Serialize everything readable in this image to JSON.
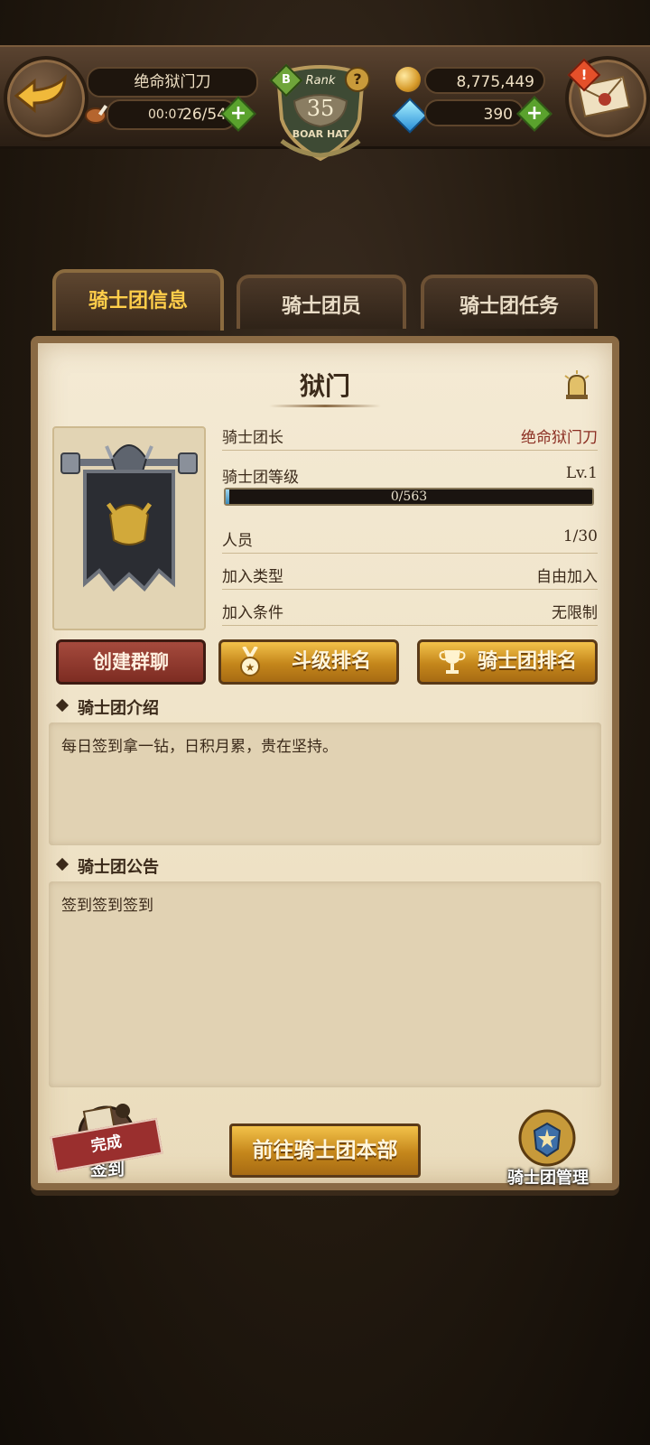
{
  "header": {
    "player_name": "绝命狱门刀",
    "timer": "00:07",
    "stamina": "26/54",
    "rank_label": "Rank",
    "rank_value": "35",
    "rank_badge": "B",
    "rank_title": "BOAR HAT",
    "gold": "8,775,449",
    "gems": "390",
    "alert": "!"
  },
  "tabs": [
    {
      "label": "骑士团信息",
      "active": true
    },
    {
      "label": "骑士团员",
      "active": false
    },
    {
      "label": "骑士团任务",
      "active": false
    }
  ],
  "guild": {
    "name": "狱门",
    "rows": [
      {
        "label": "骑士团长",
        "value": "绝命狱门刀"
      },
      {
        "label": "骑士团等级",
        "value": "Lv.1"
      },
      {
        "label": "人员",
        "value": "1/30"
      },
      {
        "label": "加入类型",
        "value": "自由加入"
      },
      {
        "label": "加入条件",
        "value": "无限制"
      }
    ],
    "exp_text": "0/563",
    "exp_progress": 0.0
  },
  "buttons": {
    "create_chat": "创建群聊",
    "rank_level": "斗级排名",
    "guild_rank": "骑士团排名",
    "go_hq": "前往骑士团本部"
  },
  "intro": {
    "title": "骑士团介绍",
    "text": "每日签到拿一钻，日积月累，贵在坚持。"
  },
  "notice": {
    "title": "骑士团公告",
    "text": "签到签到签到"
  },
  "bottom": {
    "checkin_label": "签到",
    "checkin_stamp": "完成",
    "manage_label": "骑士团管理"
  },
  "colors": {
    "accent_gold": "#ffce4a",
    "leader_name": "#8b2e22",
    "parchment": "#f4ead4"
  }
}
